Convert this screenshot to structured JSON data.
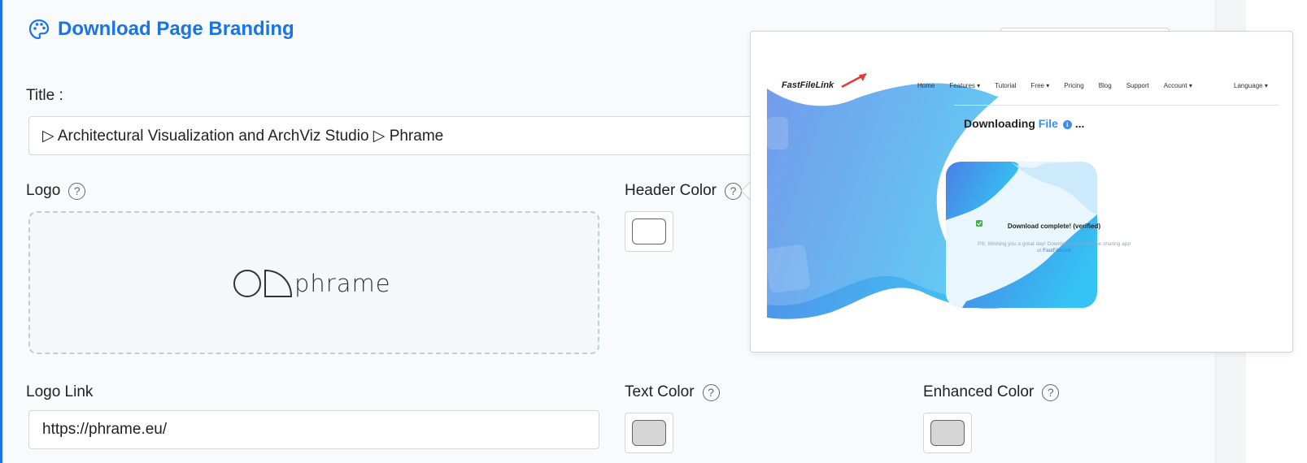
{
  "section": {
    "title": "Download Page Branding",
    "icon": "palette-icon"
  },
  "fields": {
    "title_label": "Title :",
    "title_value": "▷ Architectural Visualization and ArchViz Studio ▷ Phrame",
    "logo_label": "Logo",
    "logo_wordmark": "phrame",
    "header_color_label": "Header Color",
    "header_color": "#ffffff",
    "logo_link_label": "Logo Link",
    "logo_link_value": "https://phrame.eu/",
    "text_color_label": "Text Color",
    "text_color": "#d6d6d6",
    "enhanced_color_label": "Enhanced Color",
    "enhanced_color": "#d6d6d6",
    "help_symbol": "?"
  },
  "preview": {
    "brand": "FastFileLink",
    "menu": [
      "Home",
      "Features ▾",
      "Tutorial",
      "Free ▾",
      "Pricing",
      "Blog",
      "Support",
      "Account ▾"
    ],
    "language": "Language ▾",
    "heading_prefix": "Downloading",
    "heading_file": "File",
    "heading_suffix": "...",
    "download_status": "Download complete! (verified)",
    "ps_text": "PS: Wishing you a great day! Download your free file sharing app at",
    "ps_link": "FastFileLink"
  },
  "colors": {
    "accent": "#1a73e8",
    "wave_start": "#4b7fe6",
    "wave_end": "#35c3f3"
  }
}
